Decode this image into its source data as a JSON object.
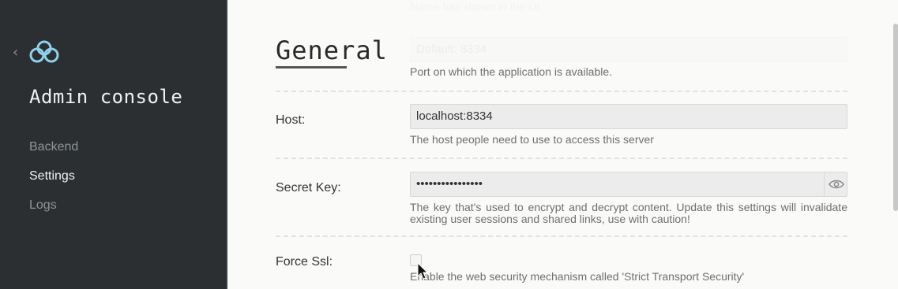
{
  "sidebar": {
    "back_icon": "chevron-left-icon",
    "logo_icon": "cloud-icon",
    "brand": "Admin console",
    "items": [
      {
        "label": "Backend",
        "active": false
      },
      {
        "label": "Settings",
        "active": true
      },
      {
        "label": "Logs",
        "active": false
      }
    ]
  },
  "main": {
    "ghost_top_help": "Name has shown in the UI",
    "ghost_port_placeholder": "Default: 8334",
    "section_title": "General",
    "port_help": "Port on which the application is available.",
    "host": {
      "label": "Host:",
      "value": "localhost:8334",
      "help": "The host people need to use to access this server"
    },
    "secret_key": {
      "label": "Secret Key:",
      "value": "••••••••••••••••",
      "toggle_icon": "eye-icon",
      "help": "The key that's used to encrypt and decrypt content. Update this settings will invalidate existing user sessions and shared links, use with caution!"
    },
    "force_ssl": {
      "label": "Force Ssl:",
      "checked": false,
      "help": "Enable the web security mechanism called 'Strict Transport Security'"
    }
  },
  "colors": {
    "sidebar_bg": "#2b2f31",
    "content_bg": "#fafaf9",
    "input_bg": "#ececec",
    "active_nav": "#f2f2f2",
    "inactive_nav": "#8f9498"
  }
}
